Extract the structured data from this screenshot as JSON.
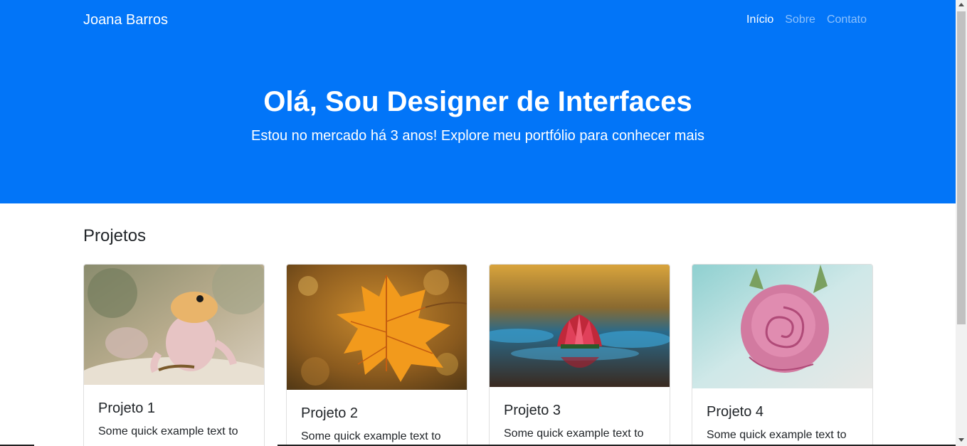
{
  "navbar": {
    "brand": "Joana Barros",
    "links": [
      {
        "label": "Início",
        "active": true
      },
      {
        "label": "Sobre",
        "active": false
      },
      {
        "label": "Contato",
        "active": false
      }
    ]
  },
  "hero": {
    "title": "Olá, Sou Designer de Interfaces",
    "subtitle": "Estou no mercado há 3 anos! Explore meu portfólio para conhecer mais",
    "background_color": "#0275f8"
  },
  "projects": {
    "heading": "Projetos",
    "cards": [
      {
        "title": "Projeto 1",
        "text": "Some quick example text to",
        "image": "gecko-photo"
      },
      {
        "title": "Projeto 2",
        "text": "Some quick example text to",
        "image": "autumn-leaf-photo"
      },
      {
        "title": "Projeto 3",
        "text": "Some quick example text to",
        "image": "water-lily-photo"
      },
      {
        "title": "Projeto 4",
        "text": "Some quick example text to",
        "image": "pink-rose-photo"
      }
    ]
  }
}
